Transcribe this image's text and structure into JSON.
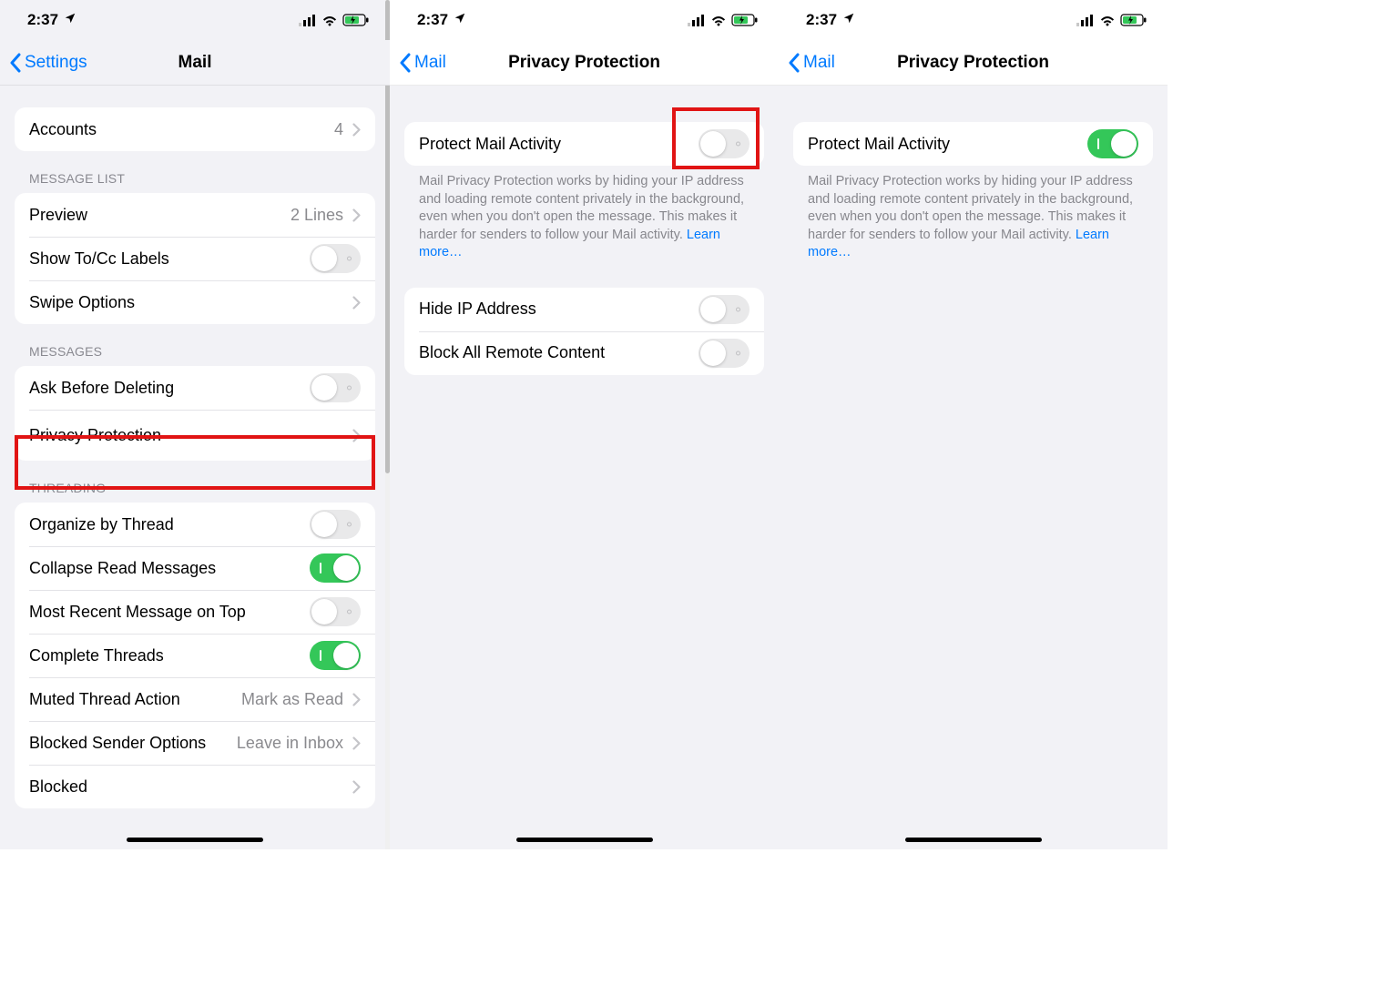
{
  "status": {
    "time": "2:37"
  },
  "screen1": {
    "back": "Settings",
    "title": "Mail",
    "accounts": {
      "label": "Accounts",
      "value": "4"
    },
    "sec_messagelist": "MESSAGE LIST",
    "preview": {
      "label": "Preview",
      "value": "2 Lines"
    },
    "showtocc": "Show To/Cc Labels",
    "swipe": "Swipe Options",
    "sec_messages": "MESSAGES",
    "askdelete": "Ask Before Deleting",
    "privacy": "Privacy Protection",
    "sec_threading": "THREADING",
    "organize": "Organize by Thread",
    "collapse": "Collapse Read Messages",
    "recent": "Most Recent Message on Top",
    "complete": "Complete Threads",
    "muted": {
      "label": "Muted Thread Action",
      "value": "Mark as Read"
    },
    "blockedsender": {
      "label": "Blocked Sender Options",
      "value": "Leave in Inbox"
    },
    "blocked": "Blocked"
  },
  "screen2": {
    "back": "Mail",
    "title": "Privacy Protection",
    "protect": "Protect Mail Activity",
    "desc": "Mail Privacy Protection works by hiding your IP address and loading remote content privately in the background, even when you don't open the message. This makes it harder for senders to follow your Mail activity. ",
    "learn": "Learn more…",
    "hideip": "Hide IP Address",
    "blockremote": "Block All Remote Content"
  },
  "screen3": {
    "back": "Mail",
    "title": "Privacy Protection",
    "protect": "Protect Mail Activity",
    "desc": "Mail Privacy Protection works by hiding your IP address and loading remote content privately in the background, even when you don't open the message. This makes it harder for senders to follow your Mail activity. ",
    "learn": "Learn more…"
  }
}
